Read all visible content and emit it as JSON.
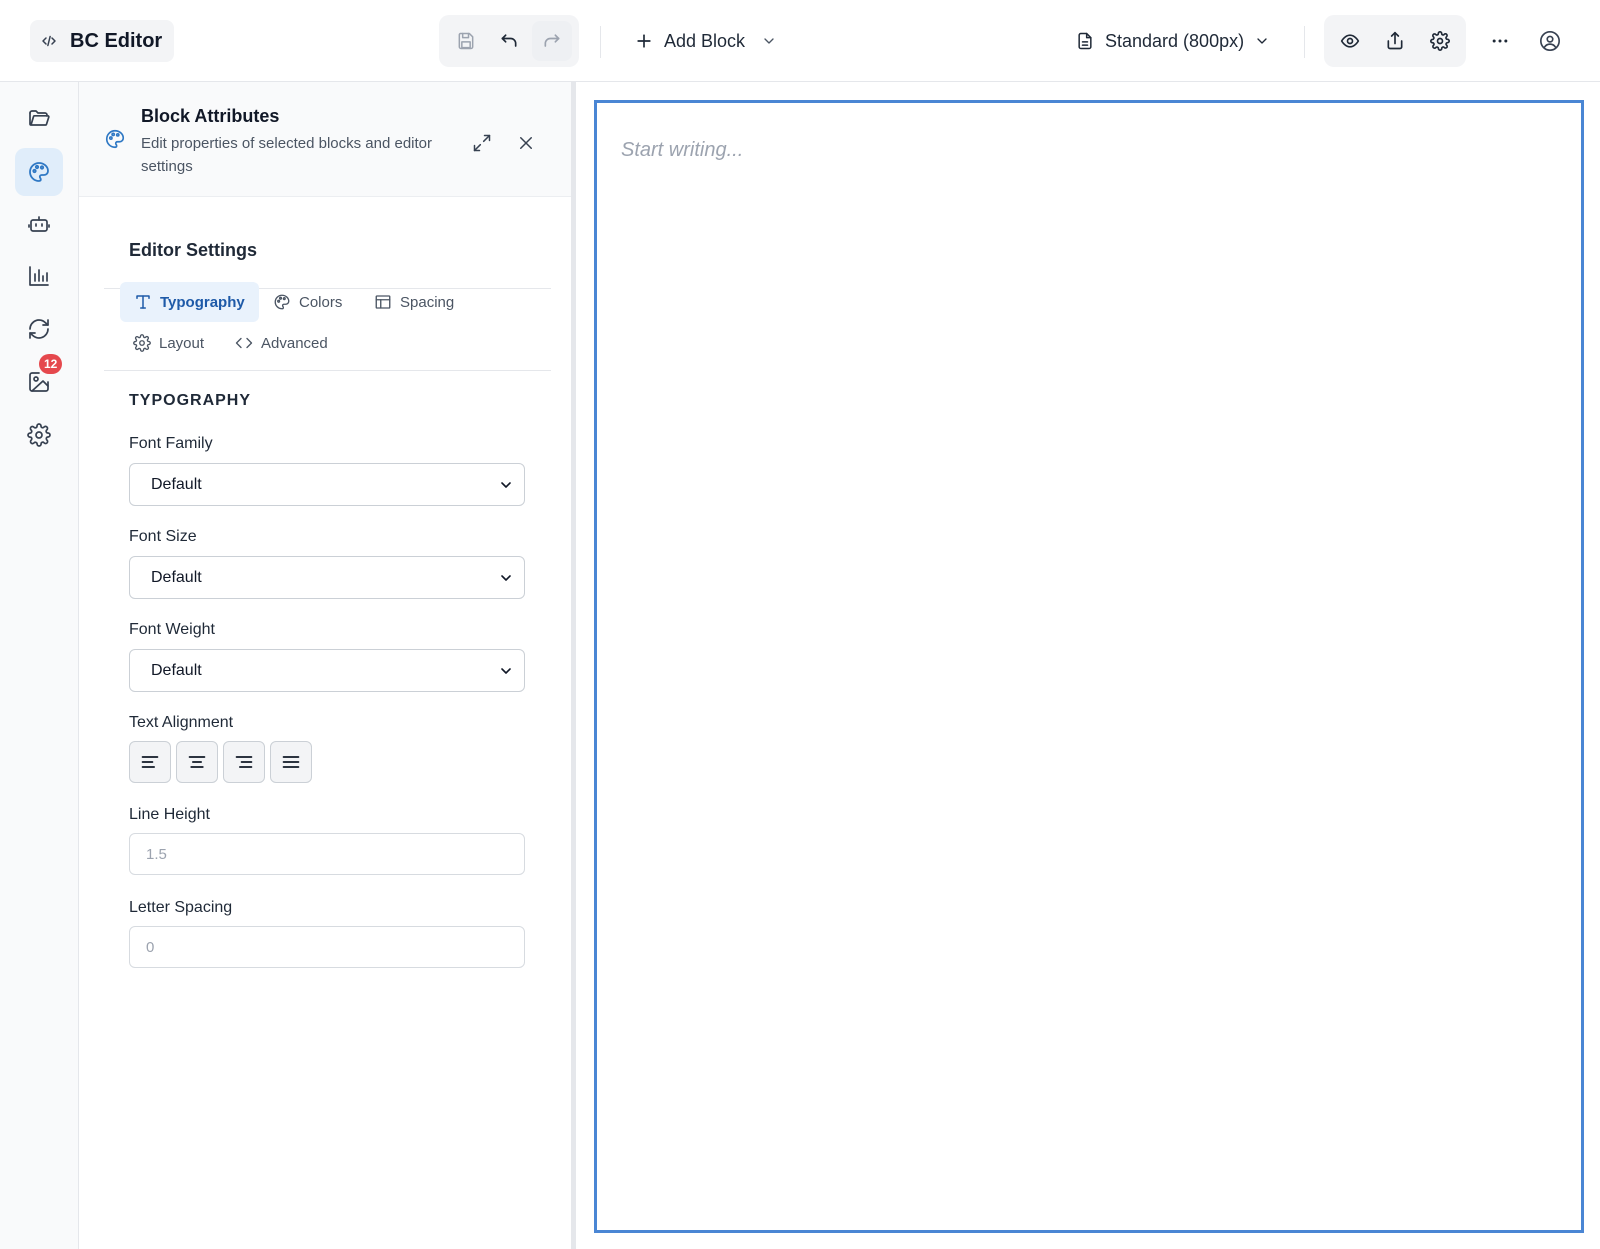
{
  "app": {
    "title": "BC Editor",
    "accent_color": "#4a86d4",
    "badge_color": "#e5484d"
  },
  "toolbar": {
    "add_block_label": "Add Block",
    "page_width_label": "Standard (800px)",
    "icons": [
      "code-icon",
      "save-icon",
      "undo-icon",
      "redo-icon",
      "plus-icon",
      "chevron-down-icon",
      "document-icon",
      "eye-icon",
      "share-icon",
      "gear-icon",
      "more-icon",
      "user-circle-icon"
    ]
  },
  "sidebar": {
    "items": [
      {
        "icon": "folder-icon",
        "active": false
      },
      {
        "icon": "palette-icon",
        "active": true
      },
      {
        "icon": "robot-icon",
        "active": false
      },
      {
        "icon": "bar-chart-icon",
        "active": false
      },
      {
        "icon": "refresh-icon",
        "active": false
      },
      {
        "icon": "image-edit-icon",
        "active": false,
        "badge": "12"
      },
      {
        "icon": "gear-icon",
        "active": false
      }
    ]
  },
  "panel": {
    "title": "Block Attributes",
    "subtitle": "Edit properties of selected blocks and editor settings",
    "section_title": "Editor Settings",
    "tabs": [
      {
        "label": "Typography",
        "icon": "type-icon",
        "active": true
      },
      {
        "label": "Colors",
        "icon": "palette-icon",
        "active": false
      },
      {
        "label": "Spacing",
        "icon": "layout-icon",
        "active": false
      },
      {
        "label": "Layout",
        "icon": "gear-icon",
        "active": false
      },
      {
        "label": "Advanced",
        "icon": "code-icon",
        "active": false
      }
    ],
    "group_title": "TYPOGRAPHY",
    "fields": {
      "font_family": {
        "label": "Font Family",
        "value": "Default"
      },
      "font_size": {
        "label": "Font Size",
        "value": "Default"
      },
      "font_weight": {
        "label": "Font Weight",
        "value": "Default"
      },
      "text_alignment": {
        "label": "Text Alignment",
        "options": [
          "left",
          "center",
          "right",
          "justify"
        ]
      },
      "line_height": {
        "label": "Line Height",
        "placeholder": "1.5"
      },
      "letter_spacing": {
        "label": "Letter Spacing",
        "placeholder": "0"
      }
    }
  },
  "canvas": {
    "placeholder": "Start writing..."
  }
}
